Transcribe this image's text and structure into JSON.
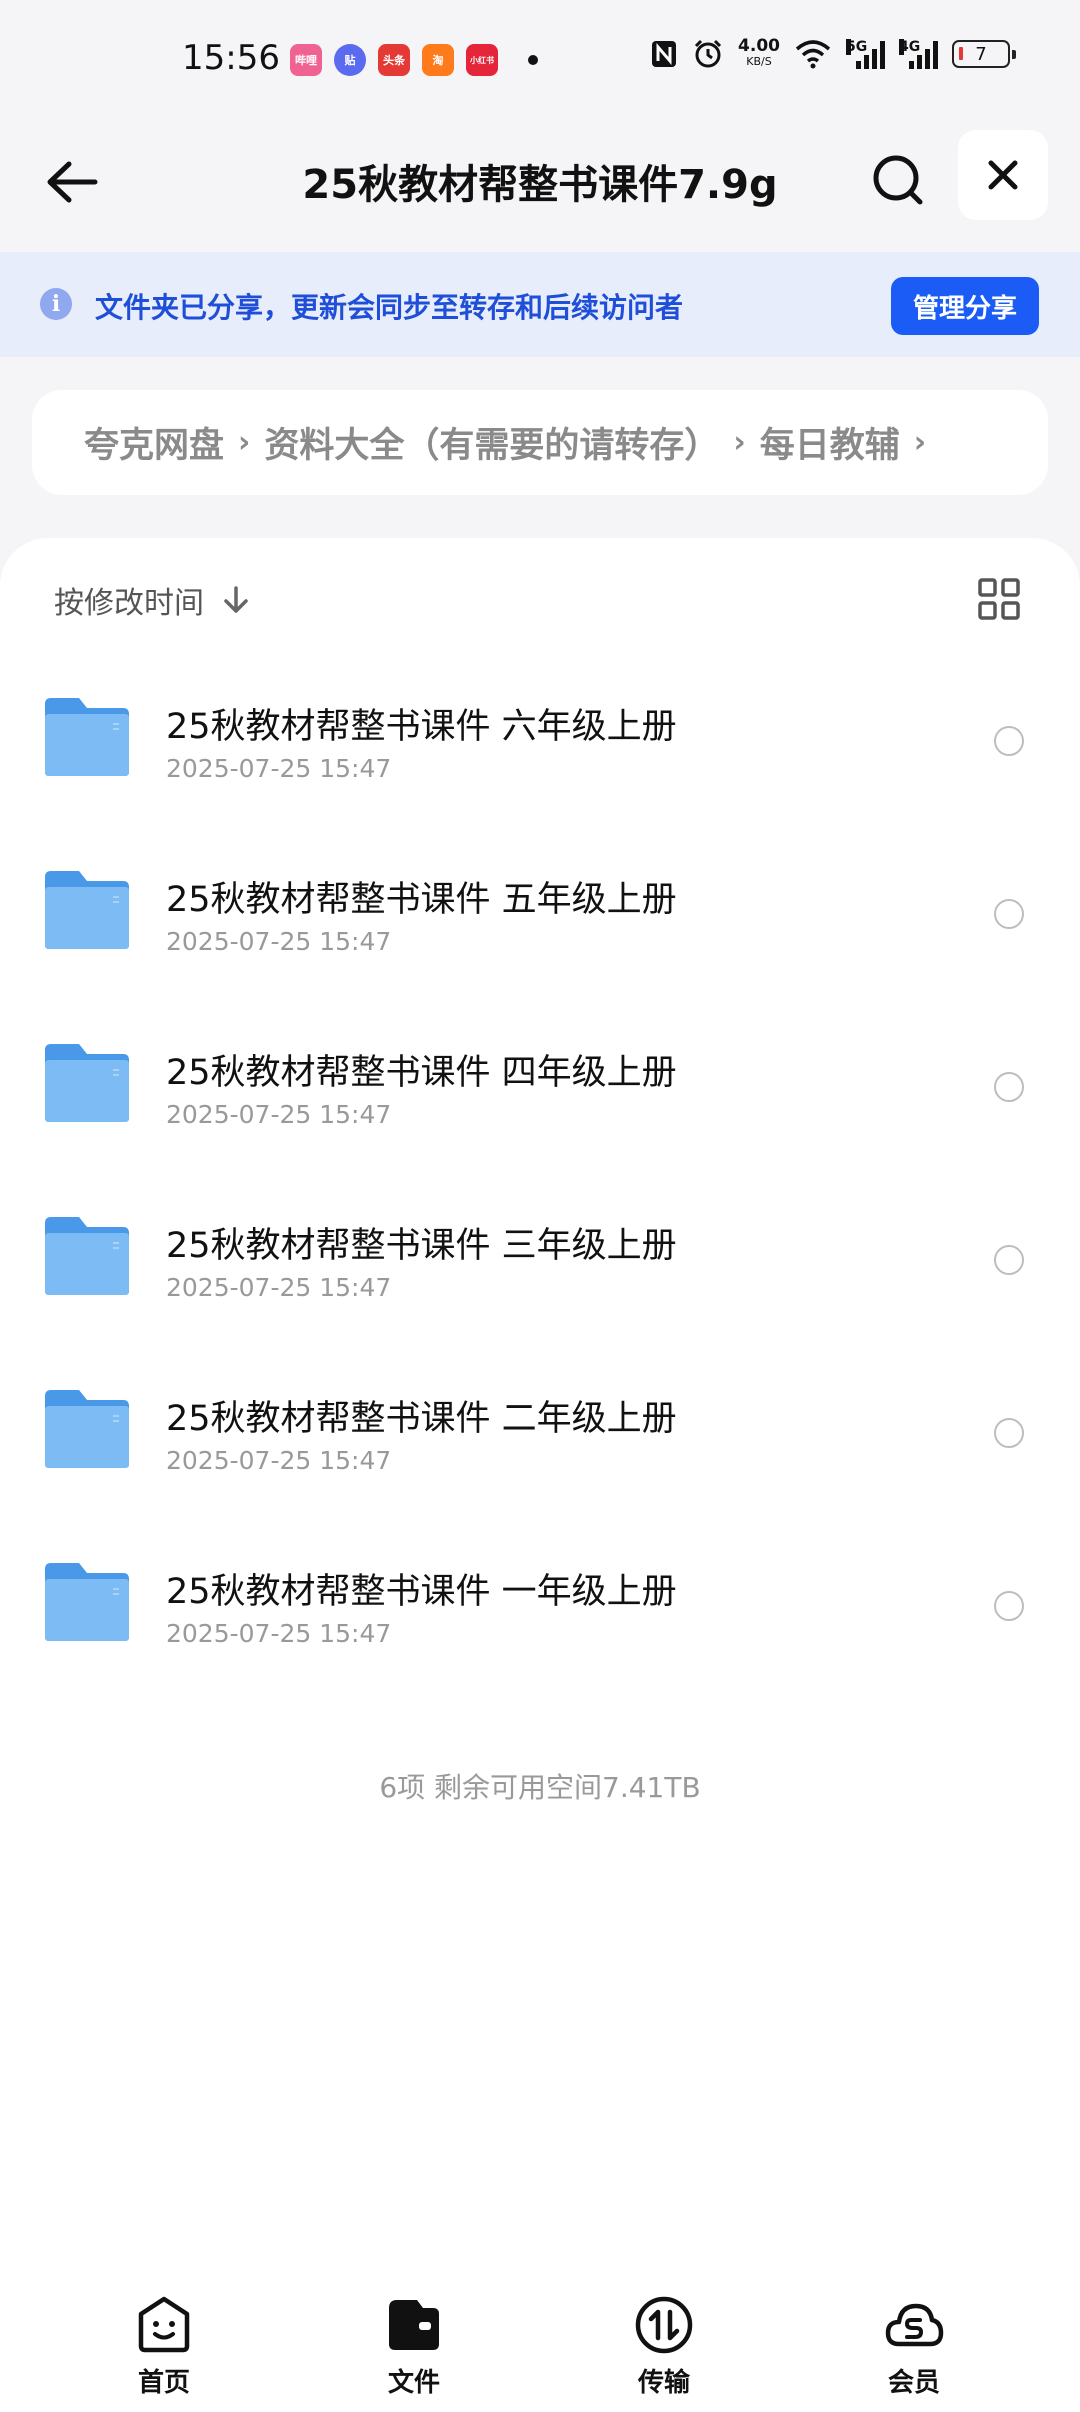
{
  "status_bar": {
    "time": "15:56",
    "apps": [
      {
        "name": "bilibili-app-icon",
        "label": "哔哩",
        "color": "#F06292"
      },
      {
        "name": "tieba-app-icon",
        "label": "贴",
        "color": "#5B6BF0"
      },
      {
        "name": "toutiao-app-icon",
        "label": "头条",
        "color": "#E53935"
      },
      {
        "name": "taobao-app-icon",
        "label": "淘",
        "color": "#FF7A1A"
      },
      {
        "name": "xiaohongshu-app-icon",
        "label": "小红书",
        "color": "#E5253A"
      }
    ],
    "net_speed_value": "4.00",
    "net_speed_unit": "KB/S",
    "signal_1_label": "5G",
    "signal_2_label": "4G",
    "battery_level": "7"
  },
  "header": {
    "title": "25秋教材帮整书课件7.9g"
  },
  "notice": {
    "text": "文件夹已分享，更新会同步至转存和后续访问者",
    "manage_label": "管理分享"
  },
  "breadcrumb": {
    "items": [
      "夸克网盘",
      "资料大全（有需要的请转存）",
      "每日教辅"
    ]
  },
  "sort": {
    "label": "按修改时间"
  },
  "files": [
    {
      "name": "25秋教材帮整书课件 六年级上册",
      "date": "2025-07-25 15:47"
    },
    {
      "name": "25秋教材帮整书课件 五年级上册",
      "date": "2025-07-25 15:47"
    },
    {
      "name": "25秋教材帮整书课件 四年级上册",
      "date": "2025-07-25 15:47"
    },
    {
      "name": "25秋教材帮整书课件 三年级上册",
      "date": "2025-07-25 15:47"
    },
    {
      "name": "25秋教材帮整书课件 二年级上册",
      "date": "2025-07-25 15:47"
    },
    {
      "name": "25秋教材帮整书课件 一年级上册",
      "date": "2025-07-25 15:47"
    }
  ],
  "summary": "6项 剩余可用空间7.41TB",
  "bottom_nav": [
    {
      "label": "首页",
      "icon": "home-smile-icon"
    },
    {
      "label": "文件",
      "icon": "wallet-folder-icon"
    },
    {
      "label": "传输",
      "icon": "transfer-icon"
    },
    {
      "label": "会员",
      "icon": "membership-cloud-icon"
    }
  ],
  "colors": {
    "accent": "#1A5CF5",
    "notice_bg": "#E7EDFB",
    "notice_text": "#1F4FD8",
    "folder": "#5AA7F0"
  }
}
